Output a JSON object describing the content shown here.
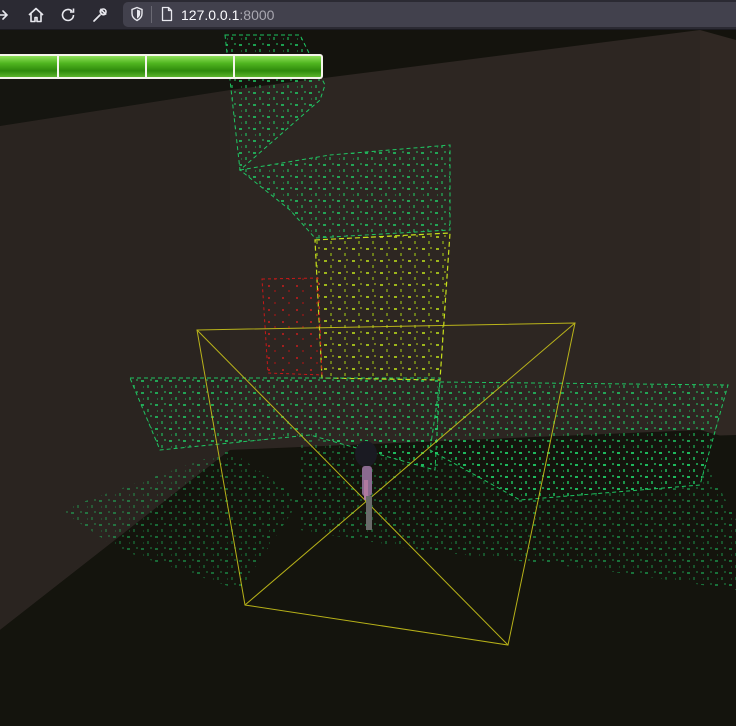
{
  "browser": {
    "url_host": "127.0.0.1",
    "url_port": ":8000",
    "icons": [
      "forward-icon",
      "home-icon",
      "reload-icon",
      "wrench-icon",
      "shield-icon",
      "page-icon"
    ]
  },
  "hud": {
    "health_segments": 4,
    "health_fraction": 1.0,
    "bar_color": "#3fa014"
  },
  "scene": {
    "glyph_color": "#1fd66a",
    "highlight_color": "#c8e01a",
    "enemy_color": "#c81818",
    "selection_box_color": "#c9c31a"
  }
}
